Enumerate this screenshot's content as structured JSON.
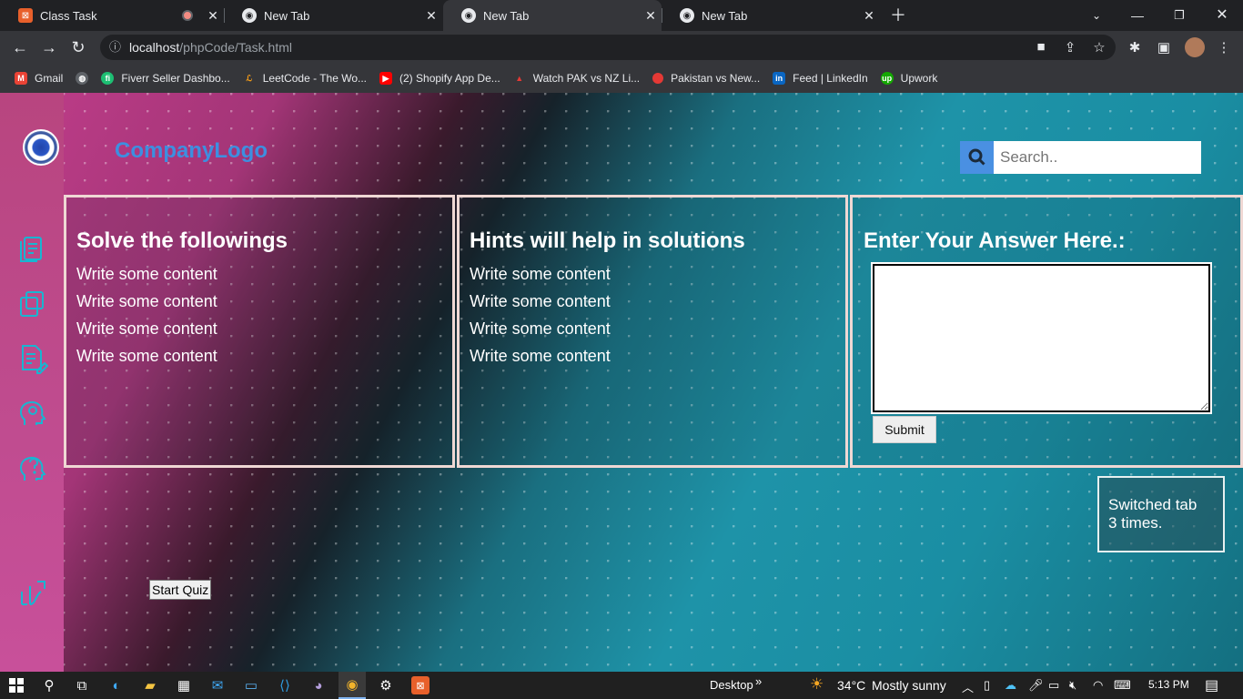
{
  "browser": {
    "tabs": [
      {
        "title": "Class Task",
        "active": false,
        "recording": true
      },
      {
        "title": "New Tab",
        "active": false
      },
      {
        "title": "New Tab",
        "active": true
      },
      {
        "title": "New Tab",
        "active": false
      }
    ],
    "url_host": "localhost",
    "url_path": "/phpCode/Task.html",
    "bookmarks": [
      "Gmail",
      "",
      "Fiverr Seller Dashbo...",
      "LeetCode - The Wo...",
      "(2) Shopify App De...",
      "Watch PAK vs NZ Li...",
      "Pakistan vs New...",
      "Feed | LinkedIn",
      "Upwork"
    ]
  },
  "header": {
    "brand": "CompanyLogo",
    "search_placeholder": "Search.."
  },
  "panels": {
    "problems": {
      "title": "Solve the followings",
      "items": [
        "Write some content",
        "Write some content",
        "Write some content",
        "Write some content"
      ]
    },
    "hints": {
      "title": "Hints will help in solutions",
      "items": [
        "Write some content",
        "Write some content",
        "Write some content",
        "Write some content"
      ]
    },
    "answer": {
      "title": "Enter Your Answer Here.:",
      "value": "",
      "submit_label": "Submit"
    }
  },
  "notice": {
    "line1": "Switched tab",
    "line2": "3 times."
  },
  "quiz_button": "Start Quiz",
  "taskbar": {
    "desktop_label": "Desktop",
    "weather_temp": "34°C",
    "weather_desc": "Mostly sunny",
    "time": "5:13 PM"
  },
  "colors": {
    "brand": "#3d8fe0",
    "search_button": "#4a90e2",
    "panel_border": "#efd8d4",
    "sidebar": "#c04c90",
    "icon_teal": "#18b6d2"
  }
}
